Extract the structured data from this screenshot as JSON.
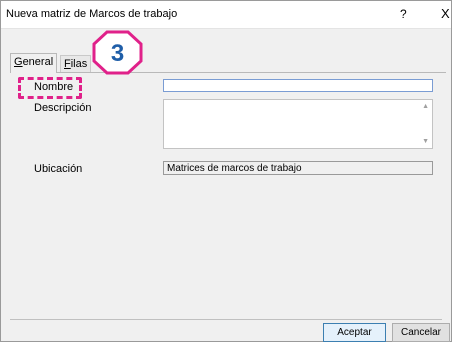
{
  "window": {
    "title": "Nueva matriz de Marcos de trabajo",
    "help_label": "?",
    "close_label": "X"
  },
  "tabs": [
    {
      "label": "General",
      "mnemonic": "G",
      "rest": "eneral",
      "selected": true
    },
    {
      "label": "Filas",
      "mnemonic": "F",
      "rest": "ilas",
      "selected": false
    }
  ],
  "form": {
    "name_label": "Nombre",
    "name_value": "",
    "description_label": "Descripción",
    "description_value": "",
    "location_label": "Ubicación",
    "location_value": "Matrices de marcos de trabajo"
  },
  "buttons": {
    "ok": "Aceptar",
    "cancel": "Cancelar"
  },
  "annotation": {
    "step_number": "3",
    "highlight_color": "#e0218a",
    "badge_color": "#1f5ea8"
  }
}
